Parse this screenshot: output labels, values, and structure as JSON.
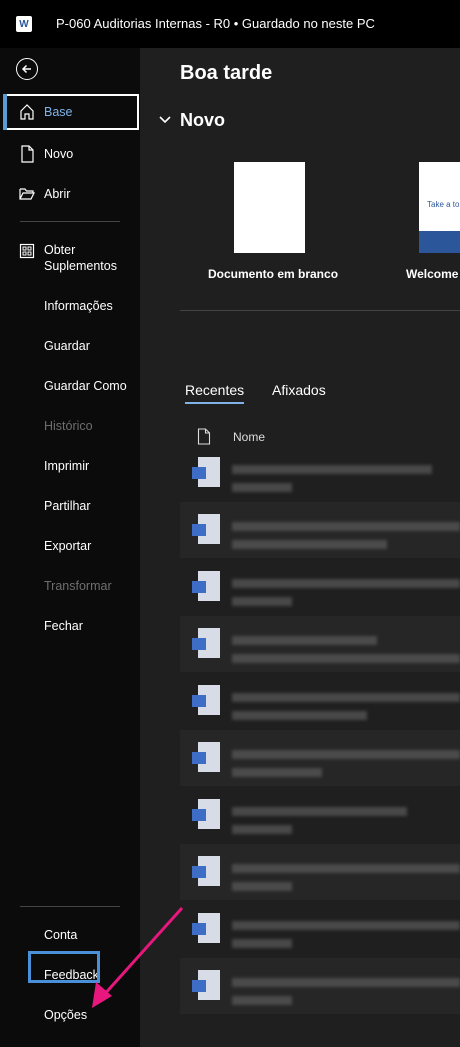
{
  "titlebar": {
    "app_letter": "W",
    "title": "P-060 Auditorias Internas - R0 • Guardado no neste PC"
  },
  "sidebar": {
    "items": [
      {
        "label": "Base"
      },
      {
        "label": "Novo"
      },
      {
        "label": "Abrir"
      },
      {
        "label": "Obter\nSuplementos"
      },
      {
        "label": "Informações"
      },
      {
        "label": "Guardar"
      },
      {
        "label": "Guardar Como"
      },
      {
        "label": "Histórico"
      },
      {
        "label": "Imprimir"
      },
      {
        "label": "Partilhar"
      },
      {
        "label": "Exportar"
      },
      {
        "label": "Transformar"
      },
      {
        "label": "Fechar"
      }
    ],
    "bottom": [
      {
        "label": "Conta"
      },
      {
        "label": "Feedback"
      },
      {
        "label": "Opções"
      }
    ]
  },
  "main": {
    "greeting": "Boa tarde",
    "novo_heading": "Novo",
    "templates": [
      {
        "label": "Documento em branco"
      },
      {
        "label": "Welcome",
        "preview_text": "Take a to"
      }
    ],
    "tabs": [
      {
        "label": "Recentes"
      },
      {
        "label": "Afixados"
      }
    ],
    "column_name": "Nome"
  },
  "colors": {
    "accent": "#7fb3e8",
    "highlight_box": "#4a90d9",
    "arrow": "#e8177e",
    "word_blue": "#2b579a"
  }
}
